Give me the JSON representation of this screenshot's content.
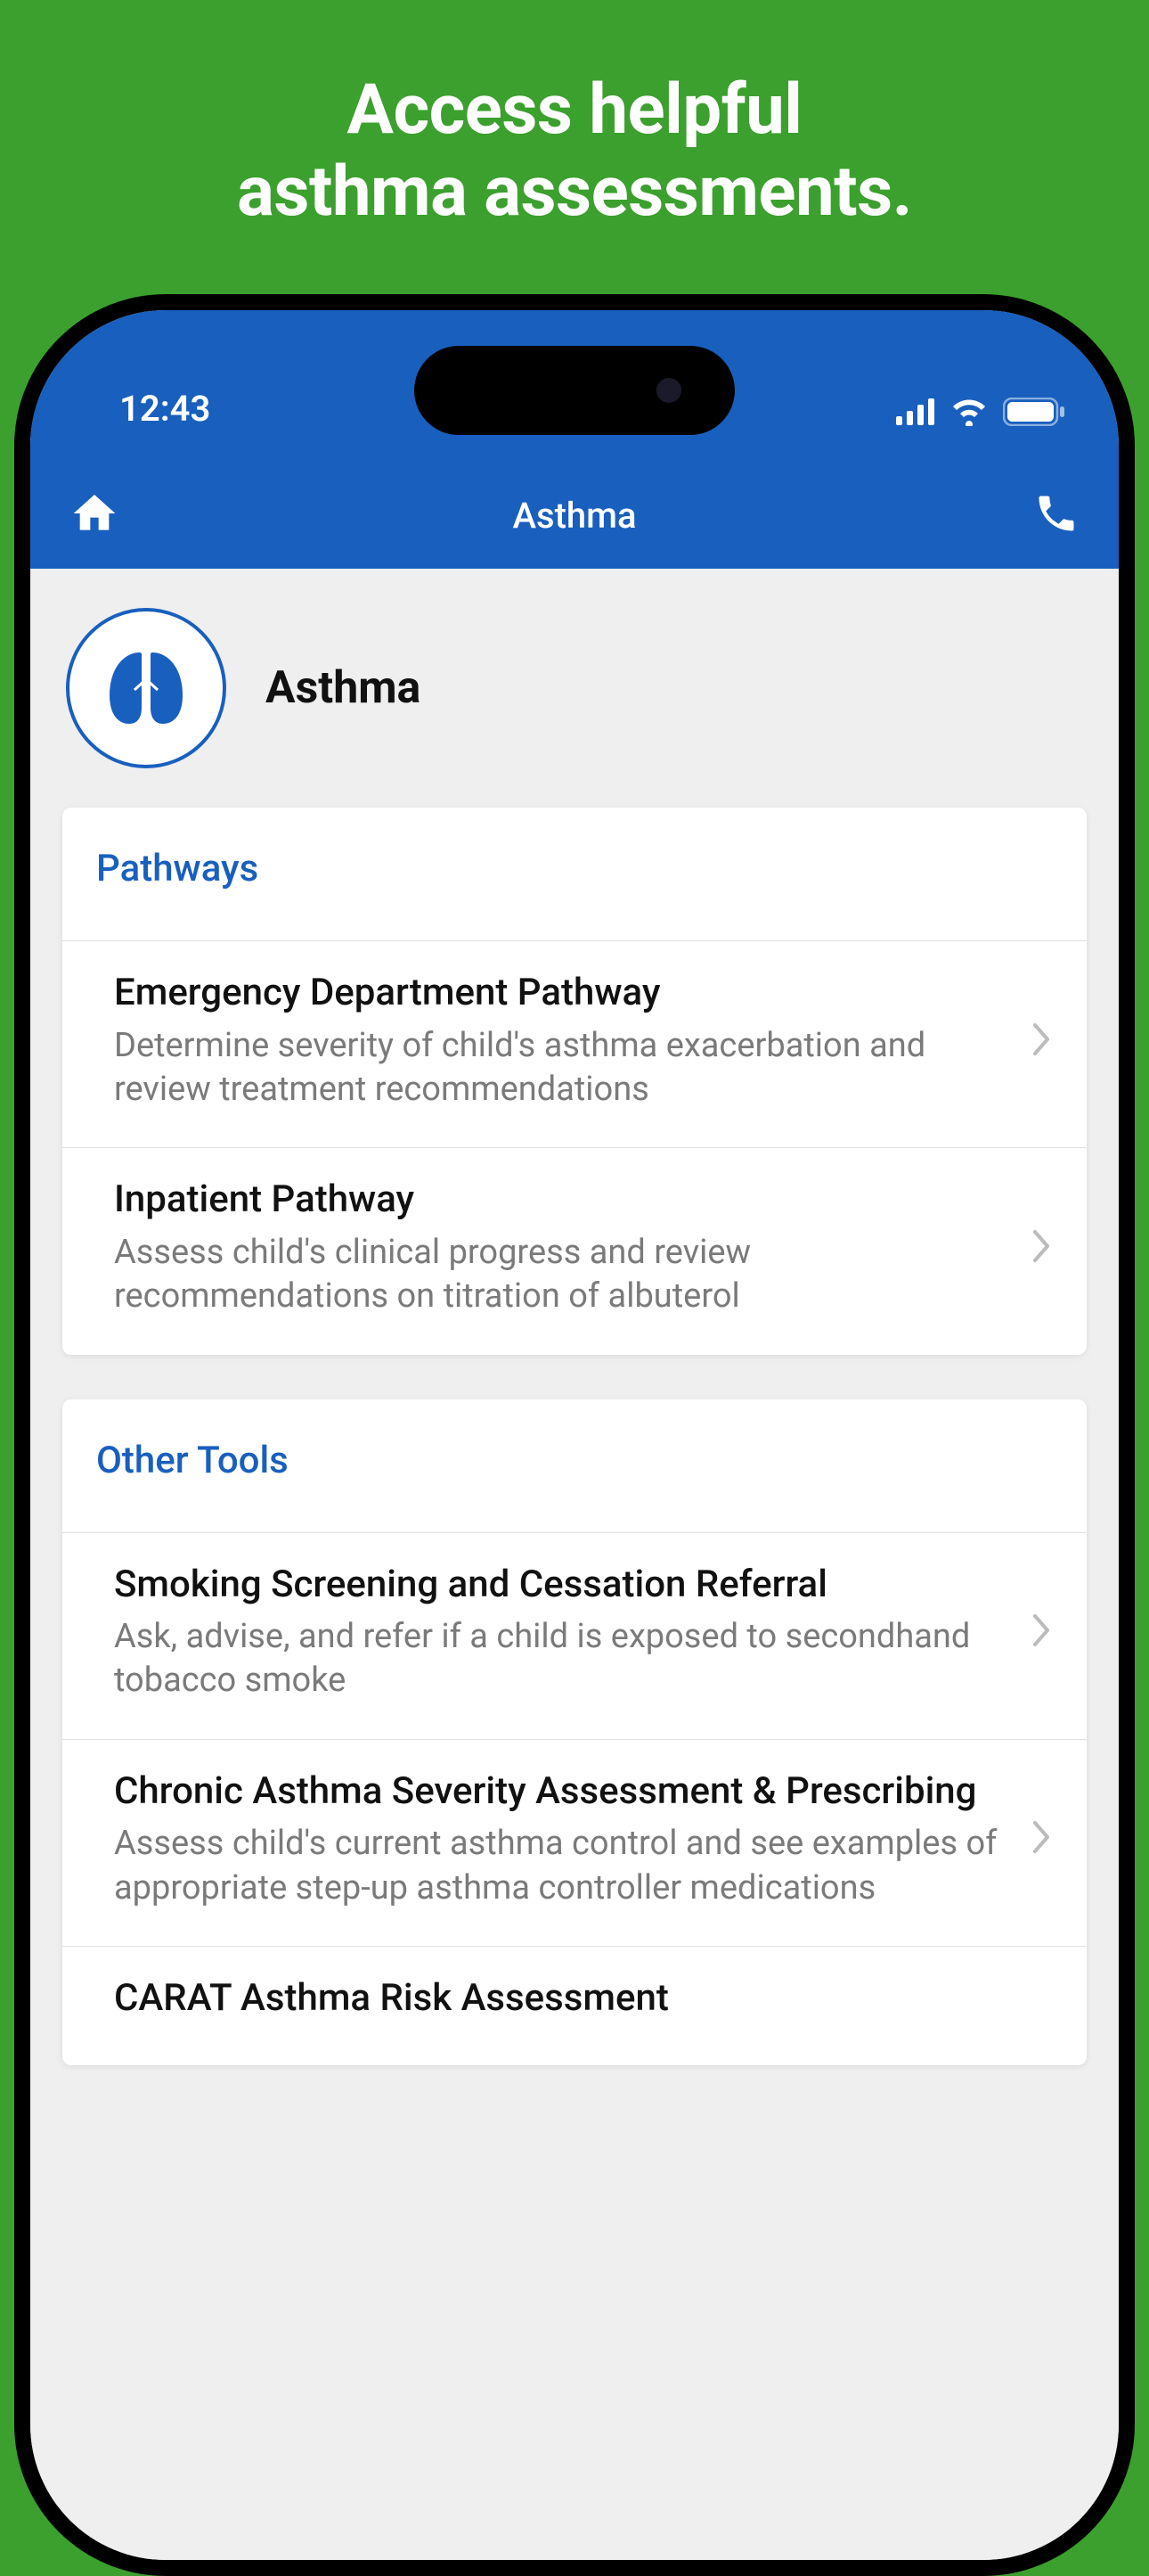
{
  "promo_title_line1": "Access helpful",
  "promo_title_line2": "asthma assessments.",
  "status": {
    "time": "12:43"
  },
  "nav": {
    "title": "Asthma"
  },
  "page": {
    "title": "Asthma",
    "icon": "lungs-icon"
  },
  "sections": [
    {
      "header": "Pathways",
      "items": [
        {
          "title": "Emergency Department Pathway",
          "desc": "Determine severity of child's asthma exacerbation and review treatment recommendations"
        },
        {
          "title": "Inpatient Pathway",
          "desc": "Assess child's clinical progress and review recommendations on titration of albuterol"
        }
      ]
    },
    {
      "header": "Other Tools",
      "items": [
        {
          "title": "Smoking Screening and Cessation Referral",
          "desc": "Ask, advise, and refer if a child is exposed to secondhand tobacco smoke"
        },
        {
          "title": "Chronic Asthma Severity Assessment & Prescribing",
          "desc": "Assess child's current asthma control and see examples of appropriate step-up asthma controller medications"
        },
        {
          "title": "CARAT Asthma Risk Assessment",
          "desc": ""
        }
      ]
    }
  ],
  "colors": {
    "background_green": "#3ca02e",
    "nav_blue": "#195fbe",
    "text_gray": "#7a7a7a"
  }
}
